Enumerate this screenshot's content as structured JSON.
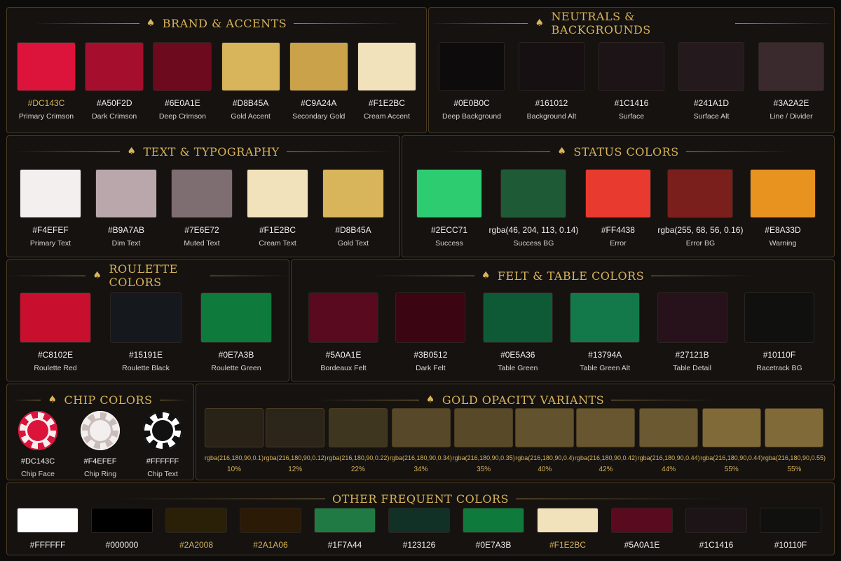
{
  "brand": {
    "title": "BRAND & ACCENTS",
    "swatches": [
      {
        "hex": "#DC143C",
        "label": "Primary Crimson",
        "color": "#DC143C"
      },
      {
        "hex": "#A50F2D",
        "label": "Dark Crimson",
        "color": "#A50F2D"
      },
      {
        "hex": "#6E0A1E",
        "label": "Deep Crimson",
        "color": "#6E0A1E"
      },
      {
        "hex": "#D8B45A",
        "label": "Gold Accent",
        "color": "#D8B45A"
      },
      {
        "hex": "#C9A24A",
        "label": "Secondary Gold",
        "color": "#C9A24A"
      },
      {
        "hex": "#F1E2BC",
        "label": "Cream Accent",
        "color": "#F1E2BC"
      }
    ]
  },
  "neutrals": {
    "title": "NEUTRALS & BACKGROUNDS",
    "swatches": [
      {
        "hex": "#0E0B0C",
        "label": "Deep Background",
        "color": "#0E0B0C"
      },
      {
        "hex": "#161012",
        "label": "Background Alt",
        "color": "#161012"
      },
      {
        "hex": "#1C1416",
        "label": "Surface",
        "color": "#1C1416"
      },
      {
        "hex": "#241A1D",
        "label": "Surface Alt",
        "color": "#241A1D"
      },
      {
        "hex": "#3A2A2E",
        "label": "Line / Divider",
        "color": "#3A2A2E"
      }
    ]
  },
  "text": {
    "title": "TEXT & TYPOGRAPHY",
    "swatches": [
      {
        "hex": "#F4EFEF",
        "label": "Primary Text",
        "color": "#F4EFEF"
      },
      {
        "hex": "#B9A7AB",
        "label": "Dim Text",
        "color": "#B9A7AB"
      },
      {
        "hex": "#7E6E72",
        "label": "Muted Text",
        "color": "#7E6E72"
      },
      {
        "hex": "#F1E2BC",
        "label": "Cream Text",
        "color": "#F1E2BC"
      },
      {
        "hex": "#D8B45A",
        "label": "Gold Text",
        "color": "#D8B45A"
      }
    ]
  },
  "status": {
    "title": "STATUS COLORS",
    "swatches": [
      {
        "hex": "#2ECC71",
        "label": "Success",
        "color": "#2ECC71"
      },
      {
        "hex": "rgba(46, 204, 113, 0.14)",
        "label": "Success BG",
        "color": "#1e5a36"
      },
      {
        "hex": "#FF4438",
        "label": "Error",
        "color": "#E83A2E"
      },
      {
        "hex": "rgba(255, 68, 56, 0.16)",
        "label": "Error BG",
        "color": "#7a1f1c"
      },
      {
        "hex": "#E8A33D",
        "label": "Warning",
        "color": "#E8921F"
      }
    ]
  },
  "roulette": {
    "title": "ROULETTE COLORS",
    "swatches": [
      {
        "hex": "#C8102E",
        "label": "Roulette Red",
        "color": "#C8102E"
      },
      {
        "hex": "#15191E",
        "label": "Roulette Black",
        "color": "#15191E"
      },
      {
        "hex": "#0E7A3B",
        "label": "Roulette Green",
        "color": "#0E7A3B"
      }
    ]
  },
  "felt": {
    "title": "FELT & TABLE COLORS",
    "swatches": [
      {
        "hex": "#5A0A1E",
        "label": "Bordeaux Felt",
        "color": "#5A0A1E"
      },
      {
        "hex": "#3B0512",
        "label": "Dark Felt",
        "color": "#3B0512"
      },
      {
        "hex": "#0E5A36",
        "label": "Table Green",
        "color": "#0E5A36"
      },
      {
        "hex": "#13794A",
        "label": "Table Green Alt",
        "color": "#13794A"
      },
      {
        "hex": "#27121B",
        "label": "Table Detail",
        "color": "#27121B"
      },
      {
        "hex": "#10110F",
        "label": "Racetrack BG",
        "color": "#10110F"
      }
    ]
  },
  "chips": {
    "title": "CHIP COLORS",
    "swatches": [
      {
        "hex": "#DC143C",
        "label": "Chip Face",
        "face": "#DC143C",
        "ring": "#F4EFEF"
      },
      {
        "hex": "#F4EFEF",
        "label": "Chip Ring",
        "face": "#F4EFEF",
        "ring": "#C9BDB9"
      },
      {
        "hex": "#FFFFFF",
        "label": "Chip Text",
        "face": "#111111",
        "ring": "#FFFFFF"
      }
    ]
  },
  "opacity": {
    "title": "GOLD OPACITY VARIANTS",
    "swatches": [
      {
        "hex": "rgba(216,180,90,0.1)",
        "label": "10%",
        "alpha": 0.1
      },
      {
        "hex": "rgba(216,180,90,0.12)",
        "label": "12%",
        "alpha": 0.12
      },
      {
        "hex": "rgba(216,180,90,0.22)",
        "label": "22%",
        "alpha": 0.22
      },
      {
        "hex": "rgba(216,180,90,0.34)",
        "label": "34%",
        "alpha": 0.34
      },
      {
        "hex": "rgba(216,180,90,0.35)",
        "label": "35%",
        "alpha": 0.35
      },
      {
        "hex": "rgba(216,180,90,0.4)",
        "label": "40%",
        "alpha": 0.4
      },
      {
        "hex": "rgba(216,180,90,0.42)",
        "label": "42%",
        "alpha": 0.42
      },
      {
        "hex": "rgba(216,180,90,0.44)",
        "label": "44%",
        "alpha": 0.44
      },
      {
        "hex": "rgba(216,180,90,0.44)",
        "label": "55%",
        "alpha": 0.55
      },
      {
        "hex": "rgba(216,180,90,0.55)",
        "label": "55%",
        "alpha": 0.55
      }
    ]
  },
  "other": {
    "title": "OTHER FREQUENT COLORS",
    "swatches": [
      {
        "hex": "#FFFFFF",
        "color": "#FFFFFF",
        "gold": false
      },
      {
        "hex": "#000000",
        "color": "#000000",
        "gold": false
      },
      {
        "hex": "#2A2008",
        "color": "#2A2008",
        "gold": true
      },
      {
        "hex": "#2A1A06",
        "color": "#2A1A06",
        "gold": true
      },
      {
        "hex": "#1F7A44",
        "color": "#1F7A44",
        "gold": false
      },
      {
        "hex": "#123126",
        "color": "#123126",
        "gold": false
      },
      {
        "hex": "#0E7A3B",
        "color": "#0E7A3B",
        "gold": false
      },
      {
        "hex": "#F1E2BC",
        "color": "#F1E2BC",
        "gold": true
      },
      {
        "hex": "#5A0A1E",
        "color": "#5A0A1E",
        "gold": false
      },
      {
        "hex": "#1C1416",
        "color": "#1C1416",
        "gold": false
      },
      {
        "hex": "#10110F",
        "color": "#10110F",
        "gold": false
      }
    ]
  }
}
